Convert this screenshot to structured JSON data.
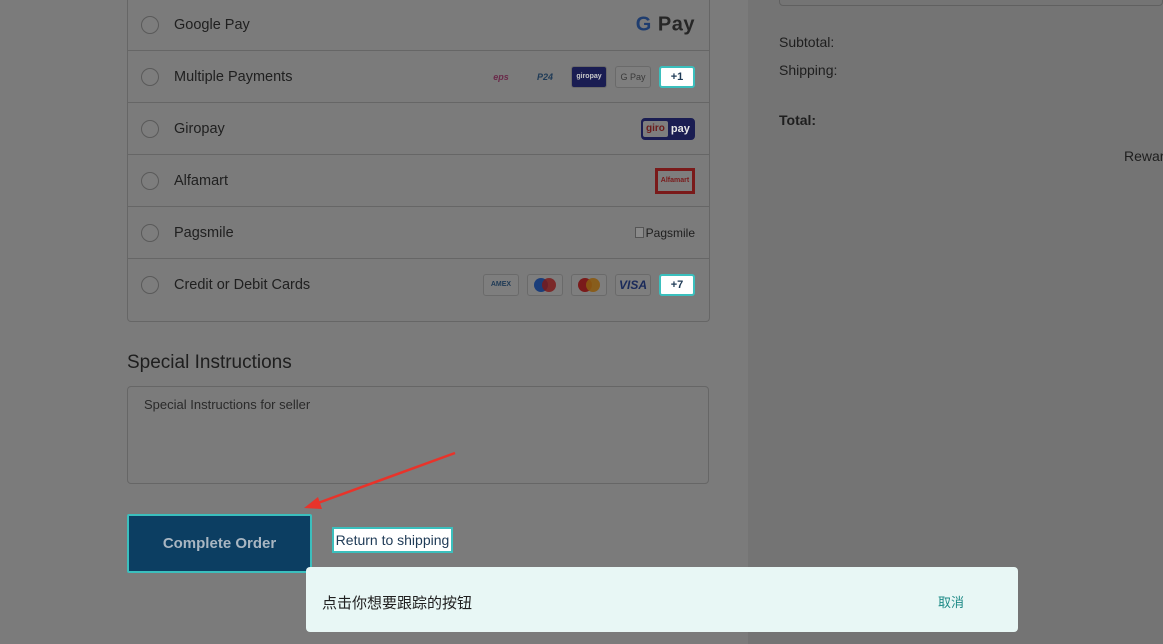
{
  "payment_methods": [
    {
      "label": "Google Pay",
      "logo": "Pay"
    },
    {
      "label": "Multiple Payments",
      "more": "+1",
      "cards": [
        "eps",
        "P24",
        "giropay",
        "G Pay"
      ]
    },
    {
      "label": "Giropay",
      "logo_giro": "giro",
      "logo_pay": "pay"
    },
    {
      "label": "Alfamart",
      "logo": "Alfamart"
    },
    {
      "label": "Pagsmile",
      "logo": "Pagsmile"
    },
    {
      "label": "Credit or Debit Cards",
      "more": "+7",
      "cards": [
        "AMEX",
        "maestro",
        "mastercard",
        "VISA"
      ]
    }
  ],
  "special_instructions": {
    "title": "Special Instructions",
    "placeholder": "Special Instructions for seller"
  },
  "actions": {
    "complete_order": "Complete Order",
    "return_link": "Return to shipping"
  },
  "summary": {
    "subtotal_label": "Subtotal:",
    "shipping_label": "Shipping:",
    "total_label": "Total:",
    "rewards_partial": "Rewar"
  },
  "toast": {
    "message": "点击你想要跟踪的按钮",
    "cancel": "取消"
  },
  "colors": {
    "accent_outline": "#3bbfbd",
    "button_bg": "#0c3e62",
    "annotation_arrow": "#e8332a",
    "toast_bg": "#e8f7f5"
  }
}
